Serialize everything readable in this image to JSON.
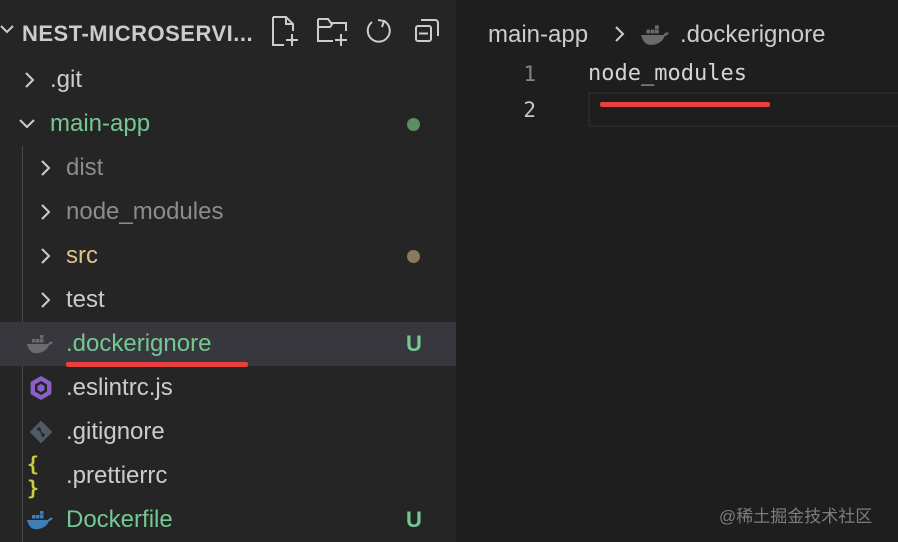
{
  "explorer": {
    "section_title": "NEST-MICROSERVI...",
    "actions": [
      {
        "name": "new-file",
        "icon": "new-file-icon"
      },
      {
        "name": "new-folder",
        "icon": "new-folder-icon"
      },
      {
        "name": "refresh",
        "icon": "refresh-icon"
      },
      {
        "name": "collapse-all",
        "icon": "collapse-all-icon"
      }
    ],
    "items": [
      {
        "label": ".git",
        "type": "folder",
        "expanded": false,
        "indent": 0,
        "color": "#cccccc"
      },
      {
        "label": "main-app",
        "type": "folder",
        "expanded": true,
        "indent": 0,
        "color": "#73c991",
        "decoration": "dot",
        "dot_color": "#5a8f66"
      },
      {
        "label": "dist",
        "type": "folder",
        "expanded": false,
        "indent": 1,
        "color": "#8c8c8c"
      },
      {
        "label": "node_modules",
        "type": "folder",
        "expanded": false,
        "indent": 1,
        "color": "#8c8c8c"
      },
      {
        "label": "src",
        "type": "folder",
        "expanded": false,
        "indent": 1,
        "color": "#e2c08d",
        "decoration": "dot",
        "dot_color": "#8c7a5e"
      },
      {
        "label": "test",
        "type": "folder",
        "expanded": false,
        "indent": 1,
        "color": "#cccccc"
      },
      {
        "label": ".dockerignore",
        "type": "file",
        "icon": "docker-icon",
        "indent": 1,
        "color": "#73c991",
        "badge": "U",
        "selected": true
      },
      {
        "label": ".eslintrc.js",
        "type": "file",
        "icon": "eslint-icon",
        "indent": 1,
        "color": "#cccccc"
      },
      {
        "label": ".gitignore",
        "type": "file",
        "icon": "git-icon",
        "indent": 1,
        "color": "#cccccc"
      },
      {
        "label": ".prettierrc",
        "type": "file",
        "icon": "json-braces-icon",
        "indent": 1,
        "color": "#cccccc"
      },
      {
        "label": "Dockerfile",
        "type": "file",
        "icon": "docker-icon",
        "indent": 1,
        "color": "#73c991",
        "badge": "U"
      }
    ]
  },
  "editor": {
    "breadcrumb": {
      "folder": "main-app",
      "file": ".dockerignore",
      "file_icon": "docker-icon"
    },
    "lines": [
      {
        "number": "1",
        "text": "node_modules"
      },
      {
        "number": "2",
        "text": ""
      }
    ],
    "current_line": 2
  },
  "colors": {
    "untracked": "#73c991",
    "modified": "#e2c08d",
    "annotation": "#e8403c",
    "docker": "#3d7fb8",
    "eslint": "#8c5fc7"
  },
  "watermark": "@稀土掘金技术社区"
}
